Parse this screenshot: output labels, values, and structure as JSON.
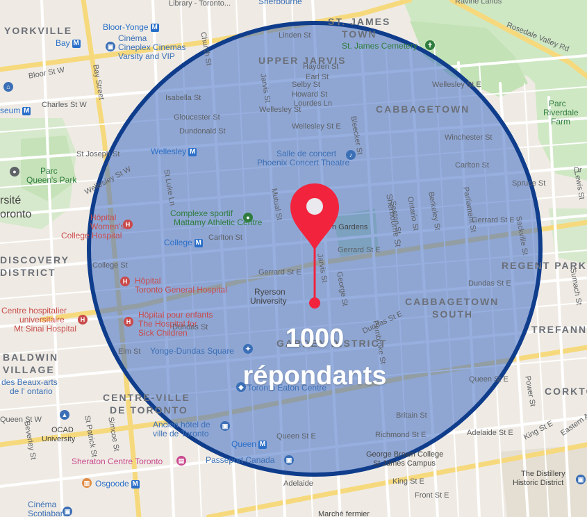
{
  "overlay": {
    "count": "1000",
    "label": "répondants",
    "circle_fill": "#3f6ec4",
    "circle_stroke": "#0f3d8c",
    "pin_color": "#f2243d"
  },
  "map": {
    "neighbourhoods": {
      "yorkville": "YORKVILLE",
      "st_james_town_1": "ST. JAMES",
      "st_james_town_2": "TOWN",
      "upper_jarvis": "UPPER JARVIS",
      "cabbagetown": "CABBAGETOWN",
      "discovery_1": "DISCOVERY",
      "discovery_2": "DISTRICT",
      "regent_park": "REGENT PARK",
      "cabbagetown_south_1": "CABBAGETOWN",
      "cabbagetown_south_2": "SOUTH",
      "trefann": "TREFANN C",
      "baldwin_1": "BALDWIN",
      "baldwin_2": "VILLAGE",
      "garden_district": "GARDEN DISTRICT",
      "centre_ville_1": "CENTRE-VILLE",
      "centre_ville_2": "DE TORONTO",
      "corktown": "CORKTO"
    },
    "places": {
      "library": "Library - Toronto...",
      "sherbourne_top": "Sherbourne",
      "ravine_lands": "Ravine Lands",
      "bloor_yonge": "Bloor-Yonge",
      "cinema1": "Cinéma",
      "cinema2": "Cineplex Cinemas",
      "cinema3": "Varsity and VIP",
      "bay": "Bay",
      "st_james_cemetery": "St. James Cemetery",
      "rosedale_valley": "Rosedale Valley Rd",
      "museum": "seum",
      "parc_riverdale_1": "Parc",
      "parc_riverdale_2": "Riverdale",
      "parc_riverdale_3": "Farm",
      "wellesley_station": "Wellesley",
      "salle_1": "Salle de concert",
      "salle_2": "Phoenix Concert Theatre",
      "parc_queens_1": "Parc",
      "parc_queens_2": "Queen's Park",
      "universite_1": "rsité",
      "universite_2": "oronto",
      "complexe_1": "Complexe sportif",
      "complexe_2": "Mattamy Athletic Centre",
      "hopital_women_1": "Hôpital",
      "hopital_women_2": "Women's",
      "hopital_women_3": "College Hospital",
      "allan_gardens": "n Gardens",
      "college_station": "College",
      "hopital_tg_1": "Hôpital",
      "hopital_tg_2": "Toronto General Hospital",
      "ryerson_1": "Ryerson",
      "ryerson_2": "University",
      "centre_hosp_1": "Centre hospitalier",
      "centre_hosp_2": "universitaire",
      "centre_hosp_3": "Mt Sinai Hospital",
      "hopital_enf_1": "Hôpital pour enfants",
      "hopital_enf_2": "The Hospital for",
      "hopital_enf_3": "Sick Children",
      "yonge_dundas": "Yonge-Dundas Square",
      "beaux_arts_1": "des Beaux-arts",
      "beaux_arts_2": "de l' ontario",
      "eaton": "Toronto Eaton Centre",
      "ocad_1": "OCAD",
      "ocad_2": "University",
      "ancien_1": "Ancien hôtel de",
      "ancien_2": "ville de Toronto",
      "queen_station": "Queen",
      "sheraton": "Sheraton Centre Toronto",
      "passeport": "Passeport Canada",
      "george_brown_1": "George Brown College",
      "george_brown_2": "St James Campus",
      "osgoode": "Osgoode",
      "distillery_1": "The Distillery",
      "distillery_2": "Historic District",
      "cinema_sb_1": "Cinéma",
      "cinema_sb_2": "Scotiabank",
      "marche": "Marché fermier"
    },
    "streets": {
      "bloor": "Bloor St W",
      "bay_st": "Bay Street",
      "church": "Church St",
      "linden": "Linden St",
      "charles_w": "Charles St W",
      "isabella": "Isabella St",
      "gloucester": "Gloucester St",
      "dundonald": "Dundonald St",
      "jarvis_top": "Jarvis St",
      "hayden": "Hayden St",
      "earl": "Earl St",
      "selby": "Selby St",
      "howard": "Howard St",
      "lourdes": "Lourdes Ln",
      "wellesley_top": "Wellesley St",
      "wellesley_e": "Wellesley St E",
      "wellesley_w": "Wellesley St W",
      "st_joseph": "St Joseph St",
      "bleecker": "Bleecker St",
      "winchester": "Winchester St",
      "wellesley_r": "Wellesley St E",
      "carlton_e": "Carlton St",
      "spruce": "Spruce St",
      "sherbourne_st": "Sherbourne St",
      "seaton": "Seaton St",
      "ontario_st": "Ontario St",
      "berkeley": "Berkeley St",
      "parliament": "Parliament St",
      "gerrard_e_r": "Gerrard St E",
      "sackville": "Sackville St",
      "carlton": "Carlton St",
      "college_st": "College St",
      "gerrard_e_mid": "Gerrard St E",
      "gerrard_st": "Gerrard St E",
      "jarvis_st": "Jarvis St",
      "george": "George St",
      "dundas_e": "Dundas St E",
      "dundas_r": "Dundas St E",
      "sumach": "Sumach St",
      "pembroke": "Pembroke St",
      "dundas_st": "Dundas St",
      "elm": "Elm St",
      "mutual": "Mutual St",
      "st_luke": "St Luke Ln",
      "queen_e": "Queen St E",
      "queen_e2": "Queen St E",
      "queen_w": "Queen St W",
      "richmond": "Richmond St E",
      "adelaide": "Adelaide St E",
      "adelaide_l": "Adelaide",
      "king_e": "King St E",
      "king_r": "King St E",
      "front": "Front St E",
      "eastern": "Eastern Av",
      "beverley": "Beverley St",
      "st_patrick": "St Patrick St",
      "simcoe": "Simcoe St",
      "britain": "Britain St",
      "power": "Power St",
      "dr": "Dr",
      "lewis": "Lewis St"
    }
  }
}
